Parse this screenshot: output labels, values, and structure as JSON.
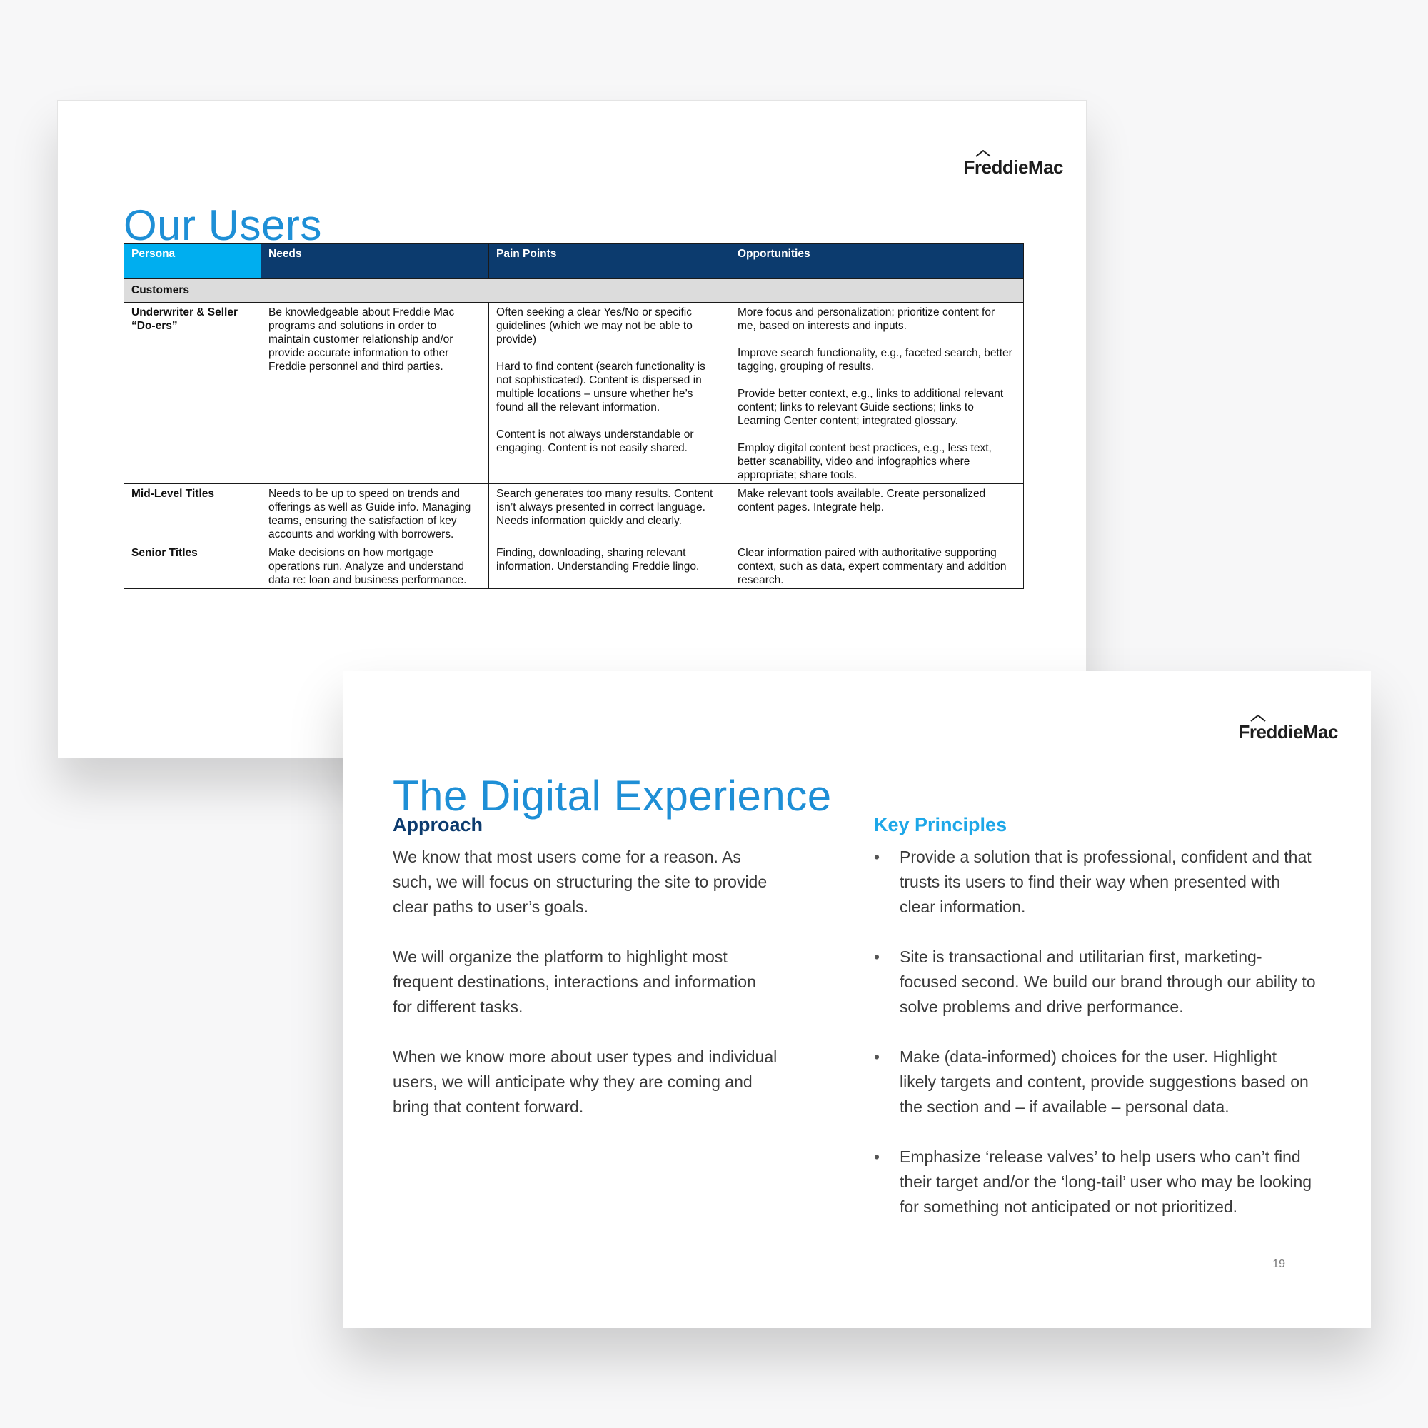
{
  "slide1": {
    "logo": "FreddieMac",
    "title": "Our Users",
    "table": {
      "headers": [
        "Persona",
        "Needs",
        "Pain Points",
        "Opportunities"
      ],
      "group_label": "Customers",
      "rows": [
        {
          "persona": "Underwriter & Seller “Do-ers”",
          "needs": [
            "Be knowledgeable about Freddie Mac programs and solutions in order to maintain customer relationship and/or provide accurate information to other Freddie personnel and third parties."
          ],
          "pain_points": [
            "Often seeking a clear Yes/No or specific guidelines (which we may not be able to provide)",
            "Hard to find content (search functionality is not sophisticated). Content is dispersed in multiple locations – unsure whether he’s found all the relevant information.",
            "Content is not always understandable or engaging. Content is not easily shared."
          ],
          "opportunities": [
            "More focus and personalization; prioritize content for me, based on interests and inputs.",
            "Improve search functionality, e.g., faceted search, better tagging, grouping of results.",
            "Provide better context, e.g., links to additional relevant content; links to relevant Guide sections; links to Learning Center content; integrated glossary.",
            "Employ digital content best practices, e.g., less text, better scanability, video and infographics where appropriate; share tools."
          ]
        },
        {
          "persona": "Mid-Level Titles",
          "needs": [
            "Needs to be up to speed on trends and offerings as well as Guide info. Managing teams, ensuring the satisfaction of key accounts and working with borrowers."
          ],
          "pain_points": [
            "Search generates too many results. Content isn’t always presented in correct language. Needs information quickly and clearly."
          ],
          "opportunities": [
            "Make relevant tools available. Create personalized content pages. Integrate help."
          ]
        },
        {
          "persona": "Senior Titles",
          "needs": [
            "Make decisions on how mortgage operations run. Analyze and understand data re: loan and business performance."
          ],
          "pain_points": [
            "Finding, downloading, sharing relevant information. Understanding Freddie lingo."
          ],
          "opportunities": [
            "Clear information paired with authoritative supporting context, such as data, expert commentary and addition research."
          ]
        }
      ]
    }
  },
  "slide2": {
    "logo": "FreddieMac",
    "title": "The Digital Experience",
    "approach": {
      "heading": "Approach",
      "paragraphs": [
        "We know that most users come for a reason. As such, we will focus on structuring the site to provide clear paths to user’s goals.",
        "We will organize the platform to highlight most frequent destinations, interactions and information for different tasks.",
        "When we know more about user types and individual users, we will anticipate why they are coming and bring that content forward."
      ]
    },
    "principles": {
      "heading": "Key Principles",
      "bullet": "•",
      "items": [
        "Provide a solution that is professional, confident and that trusts its users to find their way when presented with clear information.",
        "Site is transactional and utilitarian first, marketing-focused second. We build our brand through our ability to solve problems and drive performance.",
        "Make (data-informed) choices for the user. Highlight likely targets and content, provide suggestions based on the section and – if available – personal data.",
        "Emphasize ‘release valves’ to help users who can’t find their target and/or the ‘long-tail’ user who may be looking for something not anticipated or not prioritized."
      ]
    },
    "page_number": "19"
  },
  "colors": {
    "title_blue": "#1e8fd6",
    "header_navy": "#0c3b6e",
    "header_cyan": "#00aeef",
    "persona_blue": "#14a0e0",
    "group_gray": "#dcdcdc"
  }
}
